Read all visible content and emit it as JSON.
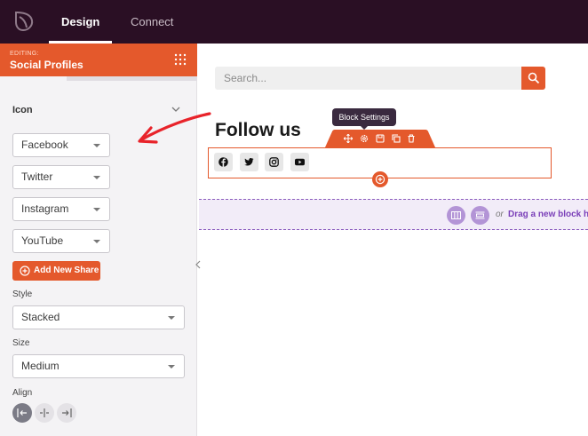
{
  "topbar": {
    "logo_icon": "seedprod-leaf-icon",
    "tabs": [
      {
        "label": "Design",
        "active": true
      },
      {
        "label": "Connect",
        "active": false
      }
    ]
  },
  "sidebar": {
    "editing_label": "EDITING:",
    "editing_title": "Social Profiles",
    "section_title": "Icon",
    "profiles": [
      "Facebook",
      "Twitter",
      "Instagram",
      "YouTube"
    ],
    "add_button_label": "Add New Share",
    "style_label": "Style",
    "style_value": "Stacked",
    "size_label": "Size",
    "size_value": "Medium",
    "align_label": "Align",
    "align_active": "left"
  },
  "canvas": {
    "search_placeholder": "Search...",
    "heading": "Follow us",
    "tooltip": "Block Settings",
    "social_icons": [
      "facebook-icon",
      "twitter-icon",
      "instagram-icon",
      "youtube-icon"
    ],
    "drop_or": "or",
    "drop_text": "Drag a new block here"
  },
  "colors": {
    "topbar": "#2a0f24",
    "accent": "#e4592c",
    "drop_zone": "#f2ecf8",
    "drop_text": "#7a3fb8",
    "annotation_arrow": "#e8232a"
  }
}
